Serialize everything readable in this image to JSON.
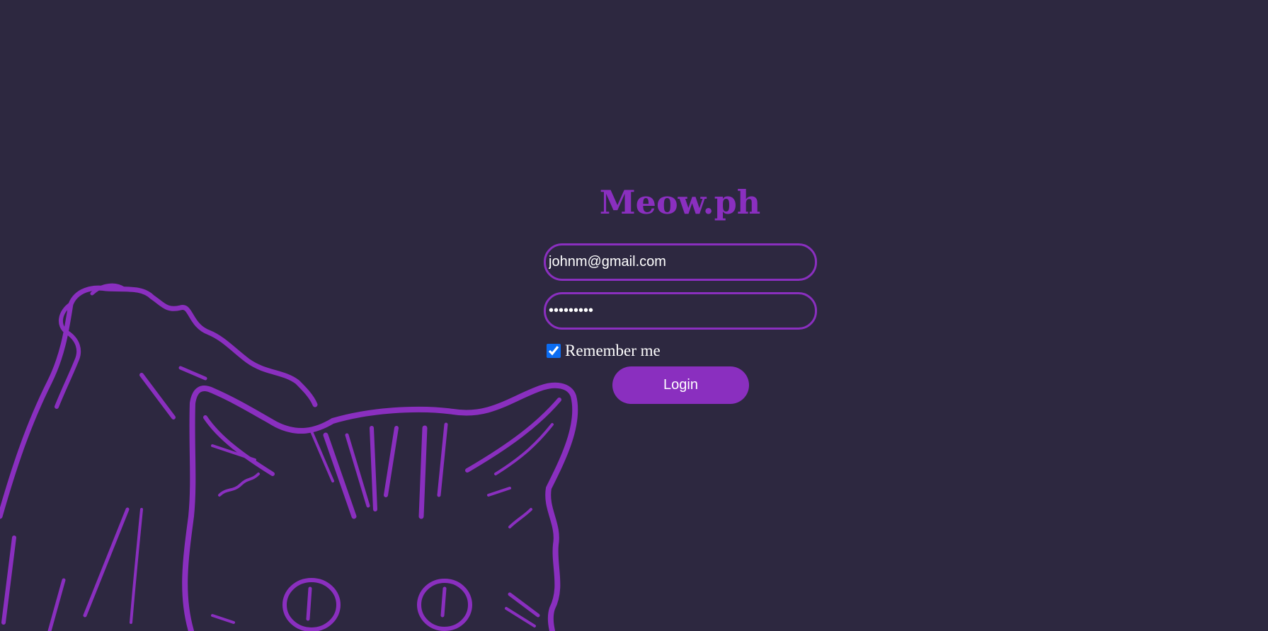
{
  "brand": {
    "title": "Meow.ph"
  },
  "login_form": {
    "email_value": "johnm@gmail.com",
    "password_value": "123456789",
    "remember_label": "Remember me",
    "remember_checked": true,
    "login_label": "Login"
  },
  "colors": {
    "background": "#2d2840",
    "accent": "#8a2fbf",
    "text": "#ffffff",
    "checkbox": "#0b6cf2"
  },
  "decor": {
    "illustration": "cat-sketch"
  }
}
